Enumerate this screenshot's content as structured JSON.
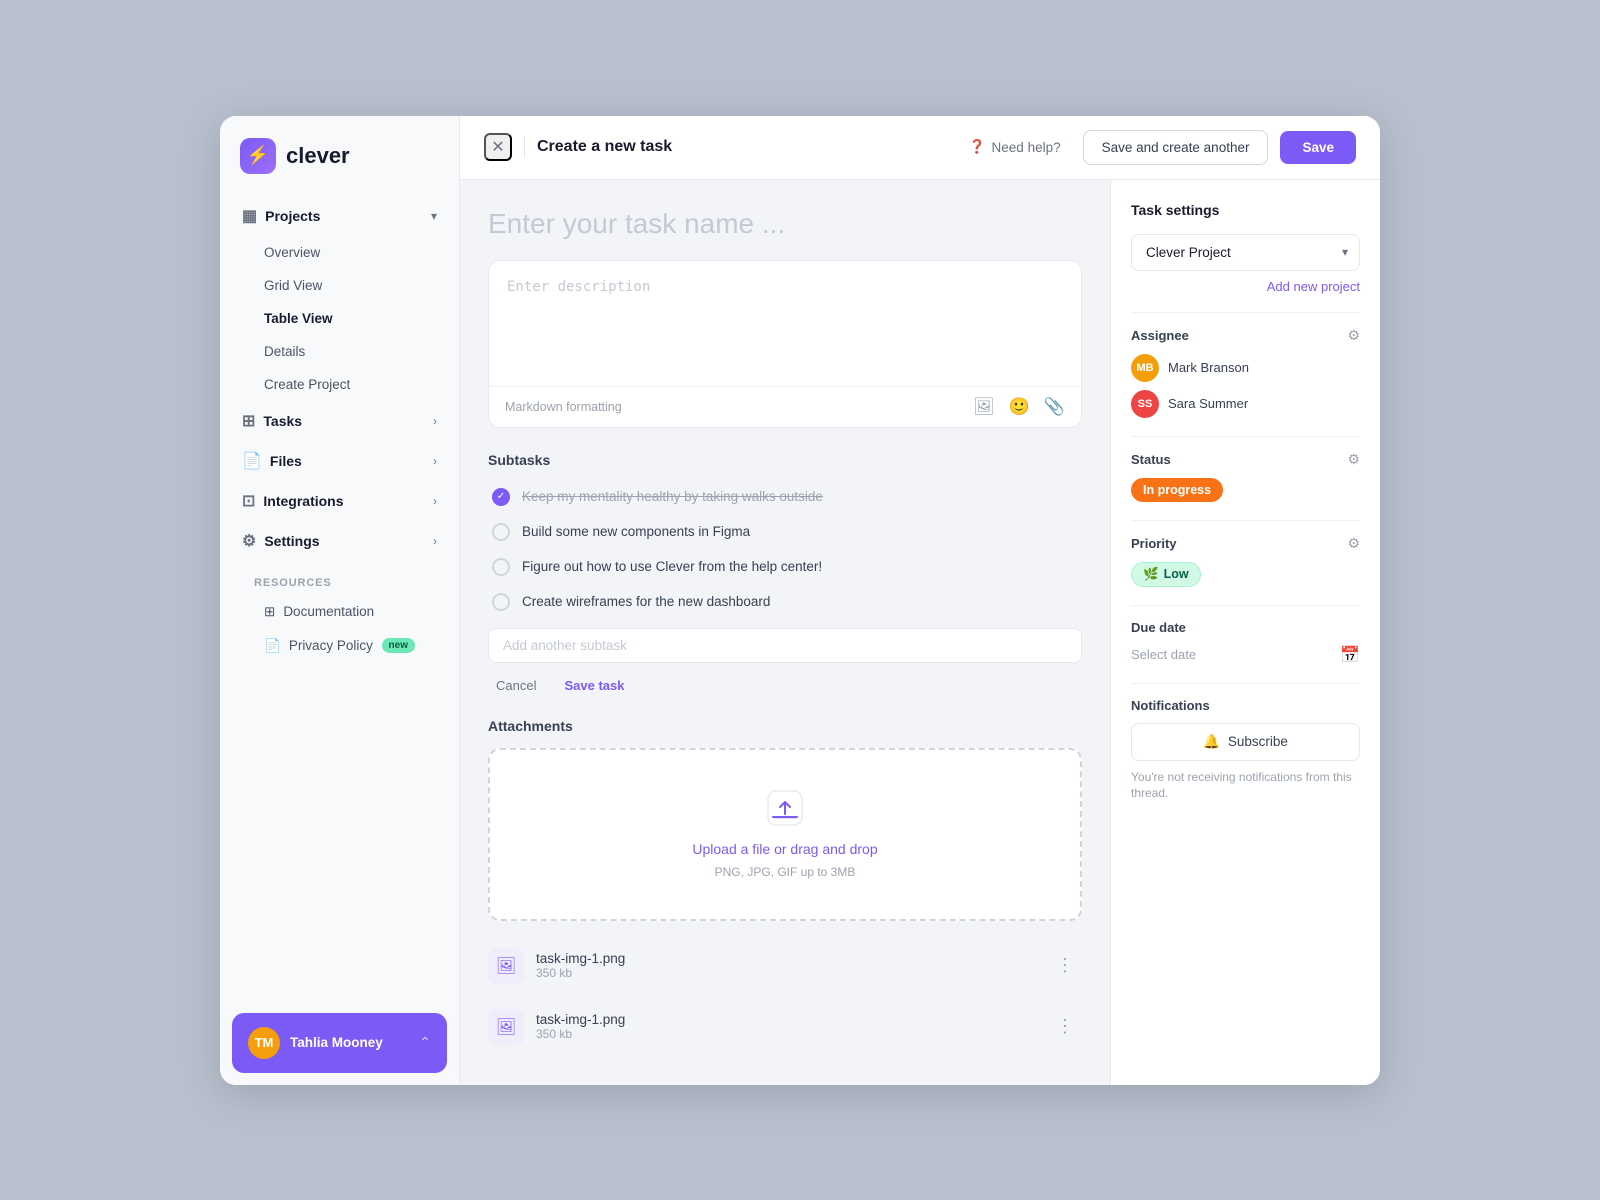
{
  "app": {
    "logo_icon": "⚡",
    "logo_text": "clever"
  },
  "sidebar": {
    "projects_label": "Projects",
    "projects_items": [
      {
        "label": "Overview",
        "active": false
      },
      {
        "label": "Grid View",
        "active": false
      },
      {
        "label": "Table View",
        "active": true
      },
      {
        "label": "Details",
        "active": false
      },
      {
        "label": "Create Project",
        "active": false
      }
    ],
    "tasks_label": "Tasks",
    "files_label": "Files",
    "integrations_label": "Integrations",
    "settings_label": "Settings",
    "resources_heading": "RESOURCES",
    "resources_items": [
      {
        "label": "Documentation"
      },
      {
        "label": "Privacy Policy",
        "badge": "new"
      }
    ],
    "user_name": "Tahlia Mooney"
  },
  "topbar": {
    "title": "Create a new task",
    "help_label": "Need help?",
    "save_another_label": "Save and create another",
    "save_label": "Save"
  },
  "task_editor": {
    "name_placeholder": "Enter your task name ...",
    "description_placeholder": "Enter description",
    "description_toolbar_label": "Markdown formatting",
    "subtasks_title": "Subtasks",
    "subtasks": [
      {
        "label": "Keep my mentality healthy by taking walks outside",
        "done": true
      },
      {
        "label": "Build some new components in Figma",
        "done": false
      },
      {
        "label": "Figure out how to use Clever from the help center!",
        "done": false
      },
      {
        "label": "Create wireframes for the new dashboard",
        "done": false
      }
    ],
    "add_subtask_placeholder": "Add another subtask",
    "cancel_label": "Cancel",
    "save_task_label": "Save task",
    "attachments_title": "Attachments",
    "upload_label": "Upload a file or drag and drop",
    "upload_sub": "PNG, JPG, GIF up to 3MB",
    "files": [
      {
        "name": "task-img-1.png",
        "size": "350 kb"
      },
      {
        "name": "task-img-1.png",
        "size": "350 kb"
      }
    ]
  },
  "task_settings": {
    "title": "Task settings",
    "project_label": "Clever Project",
    "add_project_label": "Add new project",
    "assignee_label": "Assignee",
    "assignees": [
      {
        "name": "Mark Branson",
        "color": "#f59e0b",
        "initials": "MB"
      },
      {
        "name": "Sara Summer",
        "color": "#ef4444",
        "initials": "SS"
      }
    ],
    "status_label": "Status",
    "status_value": "In progress",
    "priority_label": "Priority",
    "priority_value": "Low",
    "due_date_label": "Due date",
    "select_date_label": "Select date",
    "notifications_label": "Notifications",
    "subscribe_label": "Subscribe",
    "notifications_sub": "You're not receiving notifications from this thread."
  }
}
